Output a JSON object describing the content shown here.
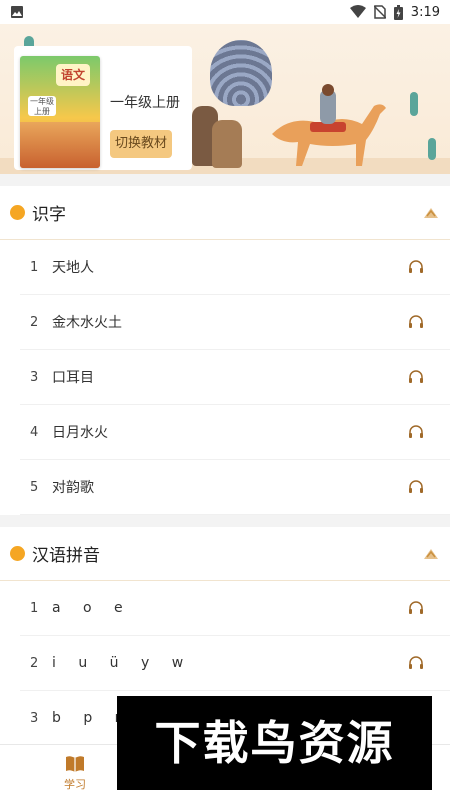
{
  "status_bar": {
    "time": "3:19",
    "icons": [
      "image-icon",
      "wifi-icon",
      "no-sim-icon",
      "battery-icon"
    ]
  },
  "banner": {
    "book_cover_title": "语文",
    "book_cover_grade": "一年级 上册",
    "grade_label": "一年级上册",
    "switch_button": "切换教材"
  },
  "sections": [
    {
      "title": "识字",
      "items": [
        {
          "num": "1",
          "name": "天地人"
        },
        {
          "num": "2",
          "name": "金木水火土"
        },
        {
          "num": "3",
          "name": "口耳目"
        },
        {
          "num": "4",
          "name": "日月水火"
        },
        {
          "num": "5",
          "name": "对韵歌"
        }
      ]
    },
    {
      "title": "汉语拼音",
      "items": [
        {
          "num": "1",
          "name": "a o e"
        },
        {
          "num": "2",
          "name": "i u ü y w"
        },
        {
          "num": "3",
          "name": "b p m f"
        }
      ]
    }
  ],
  "bottom_nav": {
    "study_label": "学习"
  },
  "watermark": {
    "text": "下载鸟资源"
  },
  "colors": {
    "accent": "#f5a623",
    "button": "#f4c880",
    "nav_active": "#c07a2a"
  }
}
